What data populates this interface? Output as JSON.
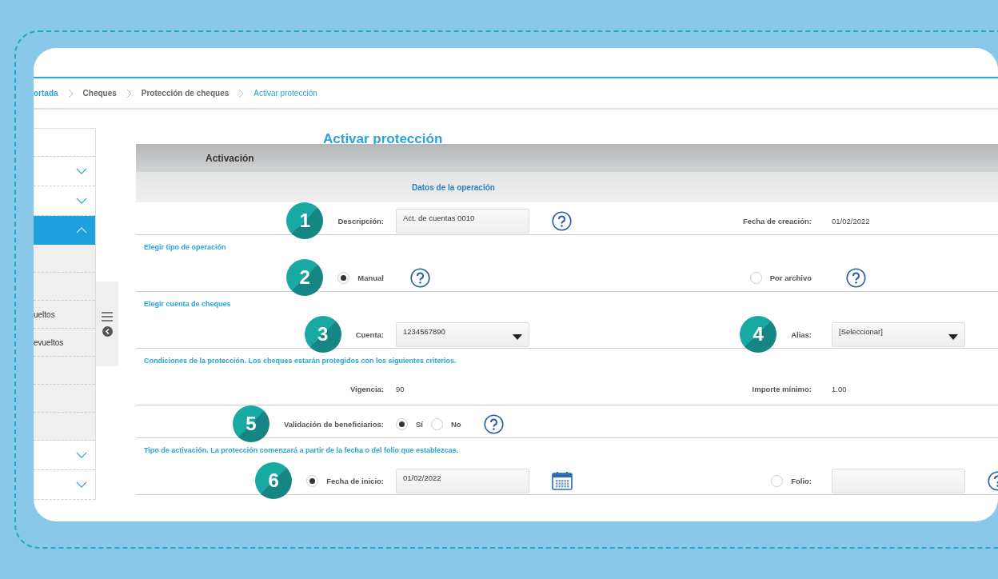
{
  "breadcrumb": [
    {
      "label": "ortada",
      "current": false,
      "kind": "home"
    },
    {
      "label": "Cheques",
      "current": false,
      "kind": "link"
    },
    {
      "label": "Protección de cheques",
      "current": false,
      "kind": "link"
    },
    {
      "label": "Activar protección",
      "current": true,
      "kind": "link"
    }
  ],
  "sidebar": {
    "items": [
      {
        "kind": "blank"
      },
      {
        "kind": "group",
        "expanded": false,
        "selected": false
      },
      {
        "kind": "group",
        "expanded": false,
        "selected": false
      },
      {
        "kind": "group",
        "expanded": true,
        "selected": true
      },
      {
        "kind": "link"
      },
      {
        "kind": "link"
      },
      {
        "kind": "link",
        "label": "ueltos"
      },
      {
        "kind": "link",
        "label": "evueltos"
      },
      {
        "kind": "link"
      },
      {
        "kind": "link"
      },
      {
        "kind": "link"
      },
      {
        "kind": "group",
        "expanded": false,
        "selected": false
      },
      {
        "kind": "group",
        "expanded": false,
        "selected": false
      }
    ]
  },
  "form": {
    "title": "Activar protección",
    "section": "Activación",
    "subsection": "Datos de la operación",
    "rows": [
      {
        "kind": "row",
        "left": [
          {
            "kind": "badge",
            "text": "1"
          },
          {
            "kind": "label",
            "text": "Descripción:"
          }
        ],
        "center": [
          {
            "kind": "input",
            "value": "Act. de cuentas 0010"
          },
          {
            "kind": "help"
          }
        ],
        "right": [
          {
            "kind": "label",
            "text": "Fecha de creación:"
          }
        ],
        "far": [
          {
            "kind": "value",
            "text": "01/02/2022"
          }
        ]
      },
      {
        "kind": "section",
        "text": "Elegir tipo de operación"
      },
      {
        "kind": "row",
        "left": [
          {
            "kind": "badge",
            "text": "2"
          },
          {
            "kind": "radio",
            "selected": true
          },
          {
            "kind": "label",
            "text": "Manual"
          }
        ],
        "center": [
          {
            "kind": "help"
          }
        ],
        "right": [
          {
            "kind": "radio",
            "selected": false
          },
          {
            "kind": "label",
            "text": "Por archivo"
          }
        ],
        "far": [
          {
            "kind": "help"
          }
        ]
      },
      {
        "kind": "section",
        "text": "Elegir cuenta de cheques"
      },
      {
        "kind": "row",
        "left": [
          {
            "kind": "badge",
            "text": "3"
          },
          {
            "kind": "label",
            "text": "Cuenta:"
          }
        ],
        "center": [
          {
            "kind": "select",
            "value": "1234567890"
          }
        ],
        "right": [
          {
            "kind": "badge",
            "text": "4"
          },
          {
            "kind": "label",
            "text": "Alias:"
          }
        ],
        "far": [
          {
            "kind": "select",
            "value": "[Seleccionar]"
          }
        ]
      },
      {
        "kind": "section",
        "text": "Condiciones de la protección. Los cheques estarán protegidos con los siguientes criterios."
      },
      {
        "kind": "row",
        "left": [
          {
            "kind": "label",
            "text": "Vigencia:"
          }
        ],
        "center": [
          {
            "kind": "value",
            "text": "90"
          }
        ],
        "right": [
          {
            "kind": "label",
            "text": "Importe mínimo:"
          }
        ],
        "far": [
          {
            "kind": "value",
            "text": "1.00"
          }
        ]
      },
      {
        "kind": "row",
        "left": [
          {
            "kind": "badge",
            "text": "5"
          },
          {
            "kind": "label",
            "text": "Validación de beneficiarios:"
          }
        ],
        "center": [
          {
            "kind": "radio",
            "selected": true
          },
          {
            "kind": "label",
            "text": "Sí"
          },
          {
            "kind": "radio",
            "selected": false
          },
          {
            "kind": "label",
            "text": "No"
          },
          {
            "kind": "help"
          }
        ]
      },
      {
        "kind": "section",
        "text": "Tipo de activación. La protección comenzará a partir de la fecha o del folio que establezcas."
      },
      {
        "kind": "row",
        "left": [
          {
            "kind": "badge",
            "text": "6"
          },
          {
            "kind": "radio",
            "selected": true
          },
          {
            "kind": "label",
            "text": "Fecha de inicio:"
          }
        ],
        "center": [
          {
            "kind": "input",
            "value": "01/02/2022"
          },
          {
            "kind": "calendar"
          }
        ],
        "right": [
          {
            "kind": "radio",
            "selected": false
          },
          {
            "kind": "label",
            "text": "Folio:"
          }
        ],
        "far": [
          {
            "kind": "input"
          },
          {
            "kind": "help"
          }
        ]
      }
    ]
  }
}
